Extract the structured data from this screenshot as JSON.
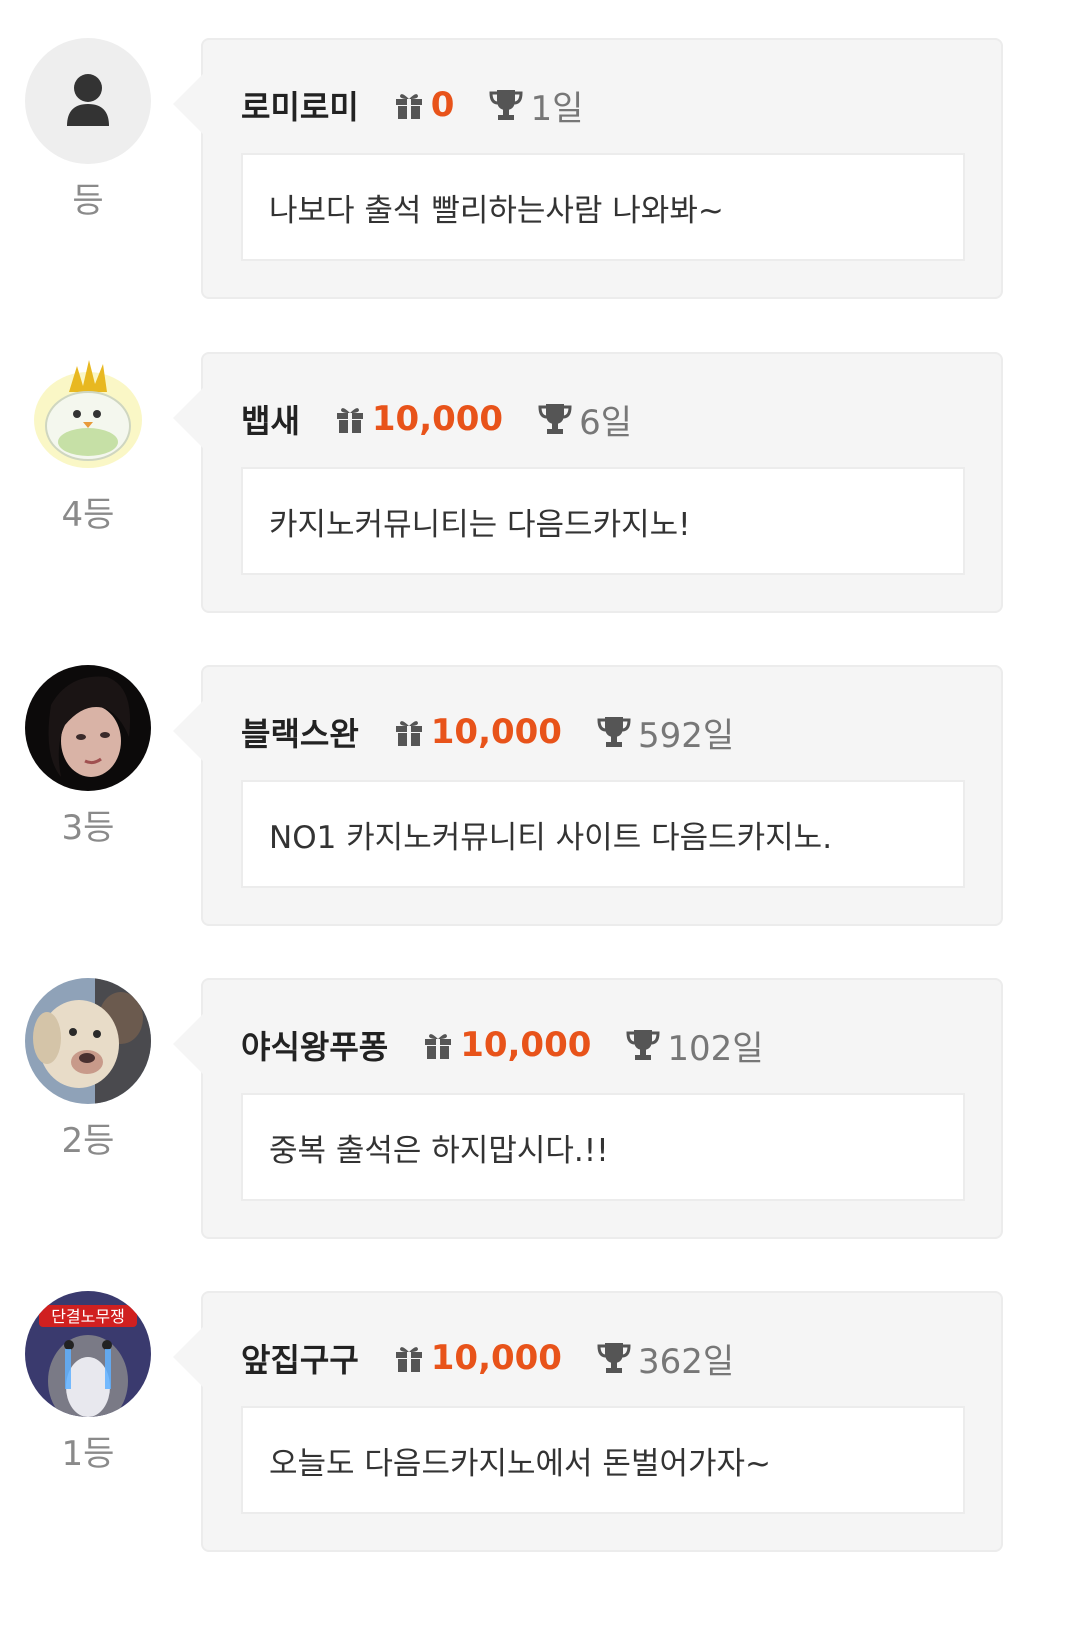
{
  "colors": {
    "accent": "#e8531a",
    "bubble_bg": "#f5f5f5",
    "rank_text": "#8a8a8a",
    "days_text": "#777777"
  },
  "entries": [
    {
      "rank": "등",
      "avatar_icon": "default-person-icon",
      "nickname": "로미로미",
      "points": "0",
      "days": "1일",
      "comment": "나보다 출석 빨리하는사람 나와봐~"
    },
    {
      "rank": "4등",
      "avatar_icon": "white-bird-character-avatar",
      "nickname": "뱁새",
      "points": "10,000",
      "days": "6일",
      "comment": "카지노커뮤니티는 다음드카지노!"
    },
    {
      "rank": "3등",
      "avatar_icon": "woman-photo-avatar",
      "nickname": "블랙스완",
      "points": "10,000",
      "days": "592일",
      "comment": "NO1 카지노커뮤니티 사이트 다음드카지노."
    },
    {
      "rank": "2등",
      "avatar_icon": "dog-photo-avatar",
      "nickname": "야식왕푸퐁",
      "points": "10,000",
      "days": "102일",
      "comment": "중복 출석은 하지맙시다.!!"
    },
    {
      "rank": "1등",
      "avatar_icon": "crying-penguin-avatar",
      "avatar_text": "단결노무쟁",
      "nickname": "앞집구구",
      "points": "10,000",
      "days": "362일",
      "comment": "오늘도 다음드카지노에서 돈벌어가자~"
    }
  ]
}
